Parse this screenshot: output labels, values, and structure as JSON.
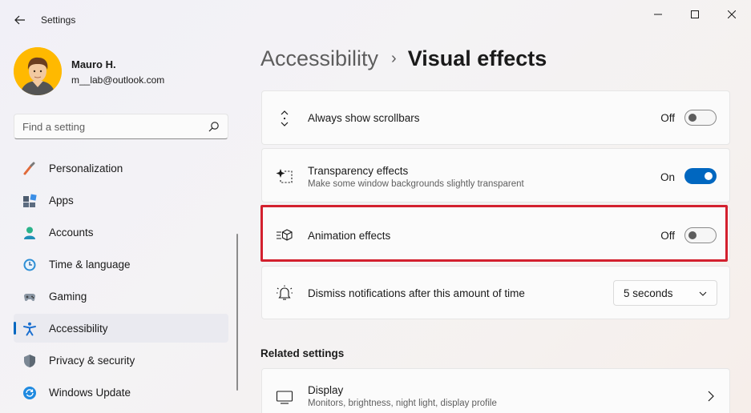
{
  "window": {
    "title": "Settings",
    "minimize_glyph": "—",
    "maximize_glyph": "☐",
    "close_glyph": "✕"
  },
  "profile": {
    "name": "Mauro H.",
    "email": "m__lab@outlook.com"
  },
  "search": {
    "placeholder": "Find a setting"
  },
  "nav": {
    "items": [
      {
        "label": "Personalization",
        "icon": "paintbrush-icon"
      },
      {
        "label": "Apps",
        "icon": "apps-icon"
      },
      {
        "label": "Accounts",
        "icon": "accounts-icon"
      },
      {
        "label": "Time & language",
        "icon": "clock-globe-icon"
      },
      {
        "label": "Gaming",
        "icon": "gamepad-icon"
      },
      {
        "label": "Accessibility",
        "icon": "accessibility-icon",
        "selected": true
      },
      {
        "label": "Privacy & security",
        "icon": "shield-icon"
      },
      {
        "label": "Windows Update",
        "icon": "windows-update-icon"
      }
    ]
  },
  "header": {
    "parent": "Accessibility",
    "separator": "›",
    "current": "Visual effects"
  },
  "settings": {
    "scrollbars": {
      "title": "Always show scrollbars",
      "state": "Off",
      "on": false
    },
    "transparency": {
      "title": "Transparency effects",
      "subtitle": "Make some window backgrounds slightly transparent",
      "state": "On",
      "on": true
    },
    "animation": {
      "title": "Animation effects",
      "state": "Off",
      "on": false
    },
    "notifications": {
      "title": "Dismiss notifications after this amount of time",
      "value": "5 seconds"
    }
  },
  "related": {
    "heading": "Related settings",
    "display": {
      "title": "Display",
      "subtitle": "Monitors, brightness, night light, display profile"
    }
  },
  "colors": {
    "accent": "#0067c0",
    "highlight": "#d3202e",
    "avatar_bg": "#ffb900"
  }
}
